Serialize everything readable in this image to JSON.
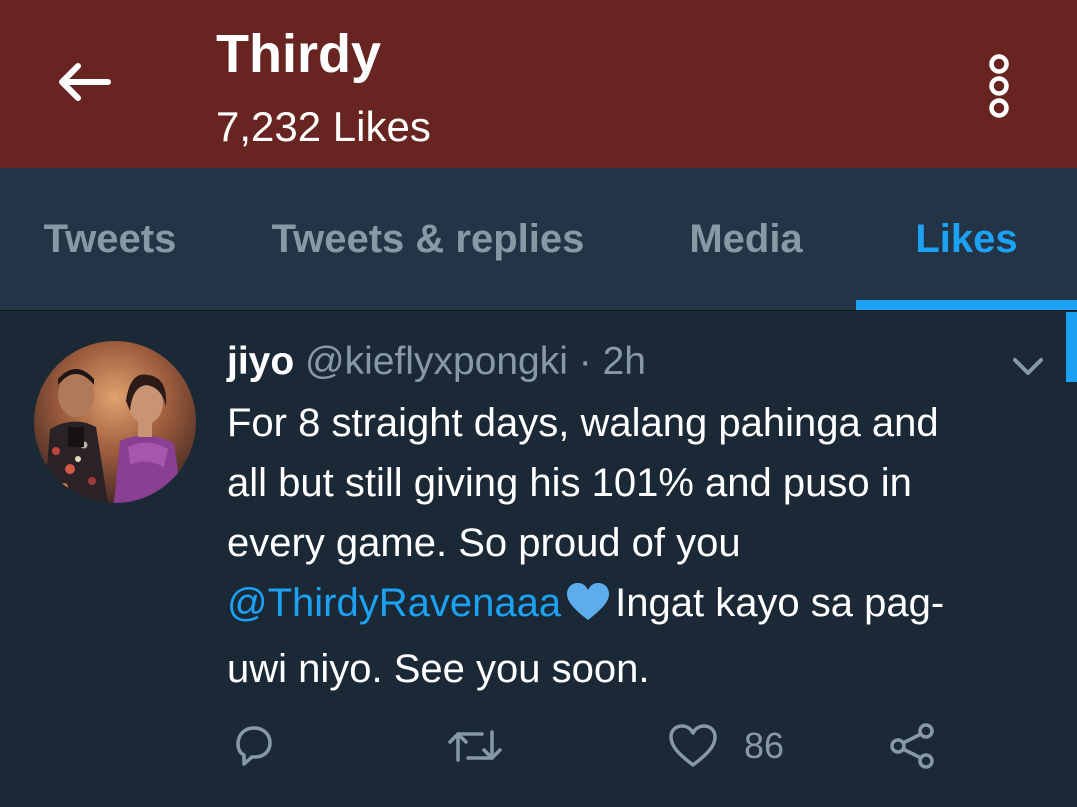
{
  "header": {
    "back_icon": "arrow-left-icon",
    "title": "Thirdy",
    "subtitle": "7,232 Likes",
    "more_icon": "vertical-dots-icon",
    "background_color": "#672421"
  },
  "tabs": [
    {
      "label": "Tweets",
      "active": false
    },
    {
      "label": "Tweets & replies",
      "active": false
    },
    {
      "label": "Media",
      "active": false
    },
    {
      "label": "Likes",
      "active": true
    }
  ],
  "tweet": {
    "author_name": "jiyo",
    "author_handle": "@kieflyxpongki",
    "separator": "·",
    "time": "2h",
    "body": {
      "line1": "For 8 straight days, walang pahinga and",
      "line2": "all but still giving his 101% and puso in",
      "line3": "every game. So proud of you",
      "mention": "@ThirdyRavenaaa",
      "emoji": "blue-heart",
      "line4_rest": "Ingat kayo sa pag-",
      "line5": "uwi niyo. See you soon."
    },
    "actions": {
      "reply_icon": "reply-icon",
      "retweet_icon": "retweet-icon",
      "like_icon": "heart-icon",
      "like_count": "86",
      "share_icon": "share-icon"
    }
  },
  "colors": {
    "accent": "#1da1f2",
    "tabbar_bg": "#243447",
    "content_bg": "#1b2836",
    "muted_text": "#8899a6"
  }
}
